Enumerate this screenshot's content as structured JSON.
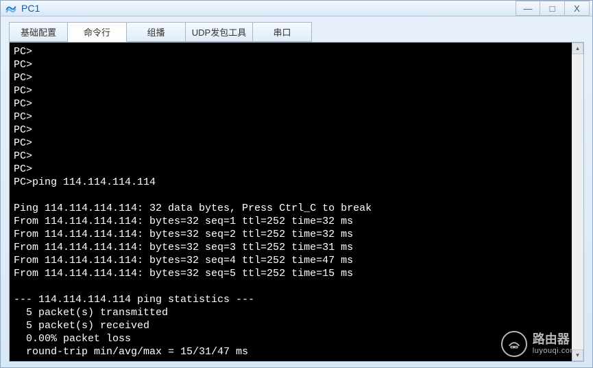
{
  "window": {
    "title": "PC1"
  },
  "tabs": [
    {
      "label": "基础配置"
    },
    {
      "label": "命令行"
    },
    {
      "label": "组播"
    },
    {
      "label": "UDP发包工具"
    },
    {
      "label": "串口"
    }
  ],
  "active_tab_index": 1,
  "terminal": {
    "lines": [
      "PC>",
      "PC>",
      "PC>",
      "PC>",
      "PC>",
      "PC>",
      "PC>",
      "PC>",
      "PC>",
      "PC>",
      "PC>ping 114.114.114.114",
      "",
      "Ping 114.114.114.114: 32 data bytes, Press Ctrl_C to break",
      "From 114.114.114.114: bytes=32 seq=1 ttl=252 time=32 ms",
      "From 114.114.114.114: bytes=32 seq=2 ttl=252 time=32 ms",
      "From 114.114.114.114: bytes=32 seq=3 ttl=252 time=31 ms",
      "From 114.114.114.114: bytes=32 seq=4 ttl=252 time=47 ms",
      "From 114.114.114.114: bytes=32 seq=5 ttl=252 time=15 ms",
      "",
      "--- 114.114.114.114 ping statistics ---",
      "  5 packet(s) transmitted",
      "  5 packet(s) received",
      "  0.00% packet loss",
      "  round-trip min/avg/max = 15/31/47 ms"
    ]
  },
  "watermark": {
    "main": "路由器",
    "sub": "luyouqi.com"
  },
  "win_controls": {
    "min": "—",
    "max": "□",
    "close": "X"
  },
  "scroll": {
    "up": "▴",
    "down": "▾"
  }
}
